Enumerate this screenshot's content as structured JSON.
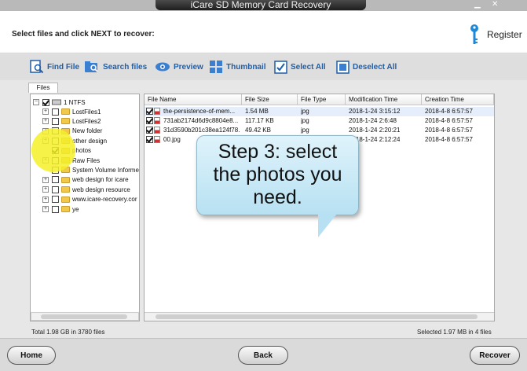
{
  "window": {
    "title": "iCare SD Memory Card Recovery",
    "minimize": "▁",
    "close": "✕"
  },
  "header": {
    "instruction": "Select files and click NEXT to recover:",
    "register": "Register"
  },
  "toolbar": {
    "find_file": "Find File",
    "search_files": "Search files",
    "preview": "Preview",
    "thumbnail": "Thumbnail",
    "select_all": "Select All",
    "deselect_all": "Deselect All"
  },
  "tabs": {
    "files": "Files"
  },
  "tree": {
    "root": "1 NTFS",
    "items": [
      {
        "label": "LostFiles1",
        "checked": false,
        "expandable": true
      },
      {
        "label": "LostFiles2",
        "checked": false,
        "expandable": true
      },
      {
        "label": "New folder",
        "checked": false,
        "expandable": true
      },
      {
        "label": "other design",
        "checked": false,
        "expandable": true
      },
      {
        "label": "photos",
        "checked": true,
        "expandable": false
      },
      {
        "label": "Raw Files",
        "checked": false,
        "expandable": true
      },
      {
        "label": "System Volume Informe",
        "checked": false,
        "expandable": false
      },
      {
        "label": "web design for icare",
        "checked": false,
        "expandable": true
      },
      {
        "label": "web design resource",
        "checked": false,
        "expandable": true
      },
      {
        "label": "www.icare-recovery.cor",
        "checked": false,
        "expandable": true
      },
      {
        "label": "ye",
        "checked": false,
        "expandable": true
      }
    ]
  },
  "file_table": {
    "columns": [
      "File Name",
      "File Size",
      "File Type",
      "Modification Time",
      "Creation Time"
    ],
    "rows": [
      {
        "name": "the-persistence-of-mem...",
        "size": "1.54 MB",
        "type": "jpg",
        "modified": "2018-1-24 3:15:12",
        "created": "2018-4-8 6:57:57",
        "checked": true
      },
      {
        "name": "731ab2174d6d9c8804e8...",
        "size": "117.17 KB",
        "type": "jpg",
        "modified": "2018-1-24 2:6:48",
        "created": "2018-4-8 6:57:57",
        "checked": true
      },
      {
        "name": "31d3590b201c38ea124f78...",
        "size": "49.42 KB",
        "type": "jpg",
        "modified": "2018-1-24 2:20:21",
        "created": "2018-4-8 6:57:57",
        "checked": true
      },
      {
        "name": "00.jpg",
        "size": "",
        "type": "",
        "modified": "2018-1-24 2:12:24",
        "created": "2018-4-8 6:57:57",
        "checked": true
      }
    ]
  },
  "status": {
    "total": "Total 1.98 GB in 3780 files",
    "selected": "Selected 1.97 MB in 4 files"
  },
  "buttons": {
    "home": "Home",
    "back": "Back",
    "recover": "Recover"
  },
  "callout": {
    "line1": "Step 3: select",
    "line2": "the photos you",
    "line3": "need."
  },
  "colors": {
    "accent": "#1f5ea8",
    "callout_bg": "#c9ebf7",
    "highlight": "#f5f028"
  }
}
